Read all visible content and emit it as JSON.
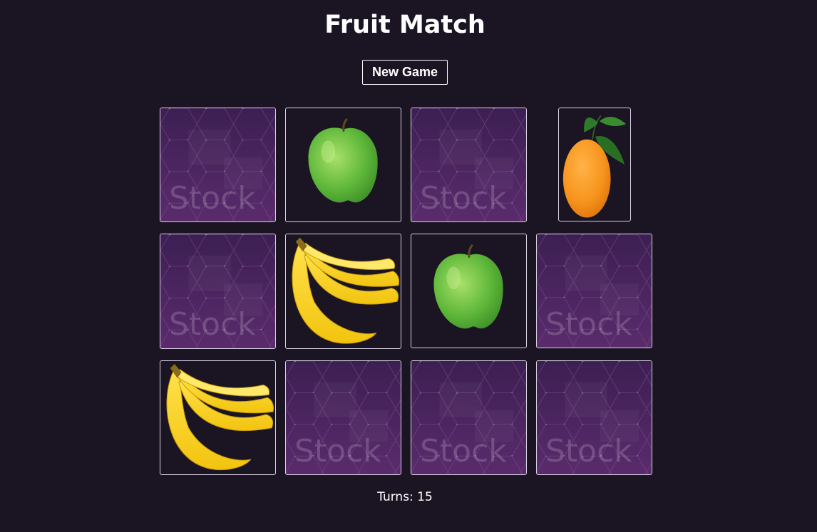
{
  "title": "Fruit Match",
  "new_game_label": "New Game",
  "turns_label": "Turns: 15",
  "card_back_watermark": "Stock",
  "colors": {
    "background": "#1b1523",
    "card_back": "#4d2560",
    "card_border": "#d9d2e3",
    "text": "#ffffff"
  },
  "cards": [
    {
      "state": "face-down",
      "fruit": null
    },
    {
      "state": "face-up",
      "fruit": "apple-icon"
    },
    {
      "state": "face-down",
      "fruit": null
    },
    {
      "state": "face-up",
      "fruit": "orange-icon"
    },
    {
      "state": "face-down",
      "fruit": null
    },
    {
      "state": "face-up",
      "fruit": "banana-icon"
    },
    {
      "state": "face-up",
      "fruit": "apple-icon"
    },
    {
      "state": "face-down",
      "fruit": null
    },
    {
      "state": "face-up",
      "fruit": "banana-icon"
    },
    {
      "state": "face-down",
      "fruit": null
    },
    {
      "state": "face-down",
      "fruit": null
    },
    {
      "state": "face-down",
      "fruit": null
    }
  ]
}
